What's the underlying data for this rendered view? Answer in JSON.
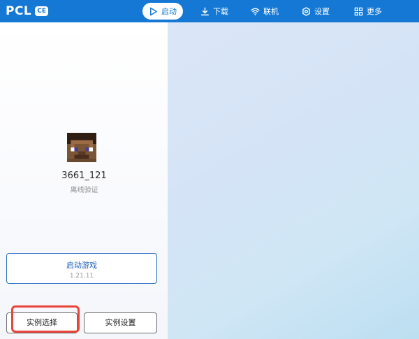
{
  "app": {
    "brand": "PCL",
    "badge": "CE"
  },
  "nav": {
    "items": [
      {
        "id": "launch",
        "label": "启动",
        "icon": "play-icon",
        "active": true
      },
      {
        "id": "download",
        "label": "下载",
        "icon": "download-icon",
        "active": false
      },
      {
        "id": "online",
        "label": "联机",
        "icon": "wifi-icon",
        "active": false
      },
      {
        "id": "settings",
        "label": "设置",
        "icon": "gear-icon",
        "active": false
      },
      {
        "id": "more",
        "label": "更多",
        "icon": "grid-icon",
        "active": false
      }
    ]
  },
  "profile": {
    "username": "3661_121",
    "auth_mode": "离线验证",
    "avatar_icon": "minecraft-steve-head-icon"
  },
  "actions": {
    "launch_label": "启动游戏",
    "launch_version": "1.21.11",
    "instance_select_label": "实例选择",
    "instance_settings_label": "实例设置"
  },
  "colors": {
    "topbar": "#1478d4",
    "accent": "#1e5fb8",
    "highlight": "#e8443a"
  }
}
